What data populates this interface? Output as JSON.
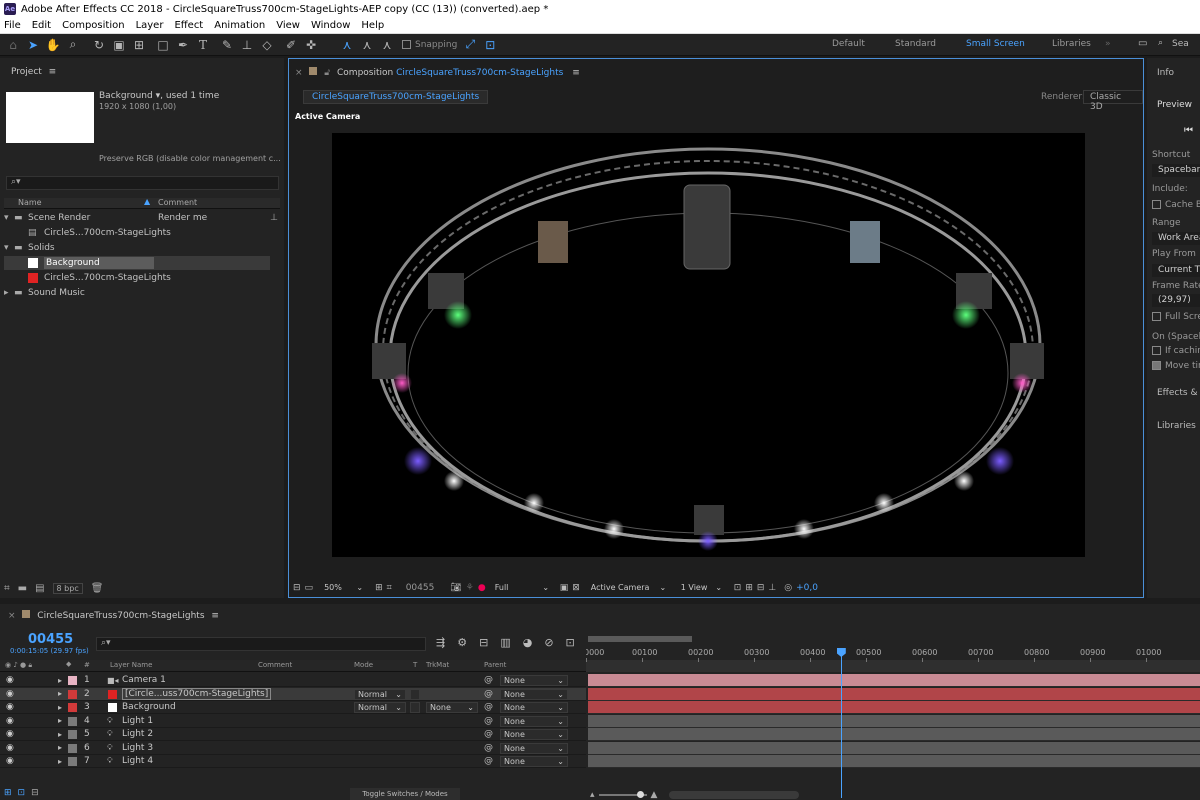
{
  "app": {
    "title": "Adobe After Effects CC 2018 - CircleSquareTruss700cm-StageLights-AEP copy (CC (13)) (converted).aep *",
    "icon_text": "Ae"
  },
  "menu": [
    "File",
    "Edit",
    "Composition",
    "Layer",
    "Effect",
    "Animation",
    "View",
    "Window",
    "Help"
  ],
  "toolbar": {
    "snapping": "Snapping",
    "workspaces": [
      "Default",
      "Standard",
      "Small Screen",
      "Libraries"
    ],
    "active_workspace": "Small Screen",
    "search": "Sea"
  },
  "project": {
    "title": "Project",
    "preview_name": "Background",
    "preview_used": ", used 1 time",
    "preview_dims": "1920 x 1080 (1,00)",
    "preview_note": "Preserve RGB (disable color management c...",
    "search_placeholder": "",
    "col_name": "Name",
    "col_comment": "Comment",
    "items": [
      {
        "name": "Scene Render",
        "comment": "Render me",
        "type": "folder"
      },
      {
        "name": "CircleS...700cm-StageLights",
        "comment": "",
        "type": "comp"
      },
      {
        "name": "Solids",
        "comment": "",
        "type": "folder"
      },
      {
        "name": "Background",
        "comment": "",
        "type": "solid-white"
      },
      {
        "name": "CircleS...700cm-StageLights",
        "comment": "",
        "type": "solid-red"
      },
      {
        "name": "Sound Music",
        "comment": "",
        "type": "folder"
      }
    ],
    "bpc": "8 bpc"
  },
  "composition": {
    "tab_prefix": "Composition",
    "name": "CircleSquareTruss700cm-StageLights",
    "sub_tab": "CircleSquareTruss700cm-StageLights",
    "renderer_label": "Renderer:",
    "renderer": "Classic 3D",
    "active_camera": "Active Camera",
    "zoom": "50%",
    "timecode": "00455",
    "resolution": "Full",
    "camera": "Active Camera",
    "views": "1 View",
    "exposure": "+0,0"
  },
  "right_panel": {
    "info": "Info",
    "preview": "Preview",
    "shortcut_label": "Shortcut",
    "shortcut": "Spacebar",
    "include": "Include:",
    "cache": "Cache Be",
    "range_label": "Range",
    "range": "Work Area",
    "play_from_label": "Play From",
    "play_from": "Current Tir",
    "frame_rate_label": "Frame Rate",
    "frame_rate": "(29,97)",
    "full_screen": "Full Scree",
    "on_label": "On (Spaceba",
    "if_caching": "If caching",
    "move_time": "Move tin",
    "effects": "Effects & P",
    "libraries": "Libraries"
  },
  "timeline": {
    "tab": "CircleSquareTruss700cm-StageLights",
    "timecode": "00455",
    "subcode": "0:00:15:05 (29.97 fps)",
    "cols": {
      "layer_name": "Layer Name",
      "comment": "Comment",
      "mode": "Mode",
      "t": "T",
      "trkmat": "TrkMat",
      "parent": "Parent"
    },
    "ruler": [
      "0000",
      "00100",
      "00200",
      "00300",
      "00400",
      "00500",
      "00600",
      "00700",
      "00800",
      "00900",
      "01000"
    ],
    "playhead_frame": 455,
    "ruler_max": 1000,
    "layers": [
      {
        "num": "1",
        "name": "Camera 1",
        "color": "#e8b4c4",
        "type": "camera",
        "mode": "",
        "trkmat": "",
        "parent": "None",
        "bar": "#c98a94"
      },
      {
        "num": "2",
        "name": "[Circle...uss700cm-StageLights]",
        "color": "#d23a3a",
        "type": "comp",
        "mode": "Normal",
        "trkmat": "",
        "parent": "None",
        "bar": "#b14549",
        "selected": true
      },
      {
        "num": "3",
        "name": "Background",
        "color": "#d23a3a",
        "type": "solid",
        "mode": "Normal",
        "trkmat": "None",
        "parent": "None",
        "bar": "#b14549"
      },
      {
        "num": "4",
        "name": "Light 1",
        "color": "#7a7a7a",
        "type": "light",
        "mode": "",
        "trkmat": "",
        "parent": "None",
        "bar": "#5a5a5a"
      },
      {
        "num": "5",
        "name": "Light 2",
        "color": "#7a7a7a",
        "type": "light",
        "mode": "",
        "trkmat": "",
        "parent": "None",
        "bar": "#5a5a5a"
      },
      {
        "num": "6",
        "name": "Light 3",
        "color": "#7a7a7a",
        "type": "light",
        "mode": "",
        "trkmat": "",
        "parent": "None",
        "bar": "#5a5a5a"
      },
      {
        "num": "7",
        "name": "Light 4",
        "color": "#7a7a7a",
        "type": "light",
        "mode": "",
        "trkmat": "",
        "parent": "None",
        "bar": "#5a5a5a"
      }
    ],
    "toggle": "Toggle Switches / Modes"
  },
  "colors": {
    "accent": "#4aa3ff",
    "panel": "#232323",
    "bg": "#1c1c1c"
  }
}
